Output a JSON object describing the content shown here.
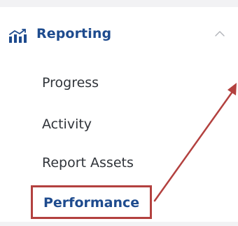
{
  "sidebar": {
    "section": {
      "title": "Reporting",
      "icon": "bar-chart-icon",
      "expanded": true,
      "toggle_icon": "chevron-up-icon"
    },
    "items": [
      {
        "label": "Progress",
        "active": false
      },
      {
        "label": "Activity",
        "active": false
      },
      {
        "label": "Report Assets",
        "active": false
      },
      {
        "label": "Performance",
        "active": true
      }
    ]
  },
  "annotation": {
    "highlight_target": "Performance",
    "highlight_color": "#b3413f",
    "arrow_color": "#b3413f"
  },
  "colors": {
    "accent": "#1e4b8e",
    "text": "#30343a",
    "divider": "#f2f2f4"
  }
}
